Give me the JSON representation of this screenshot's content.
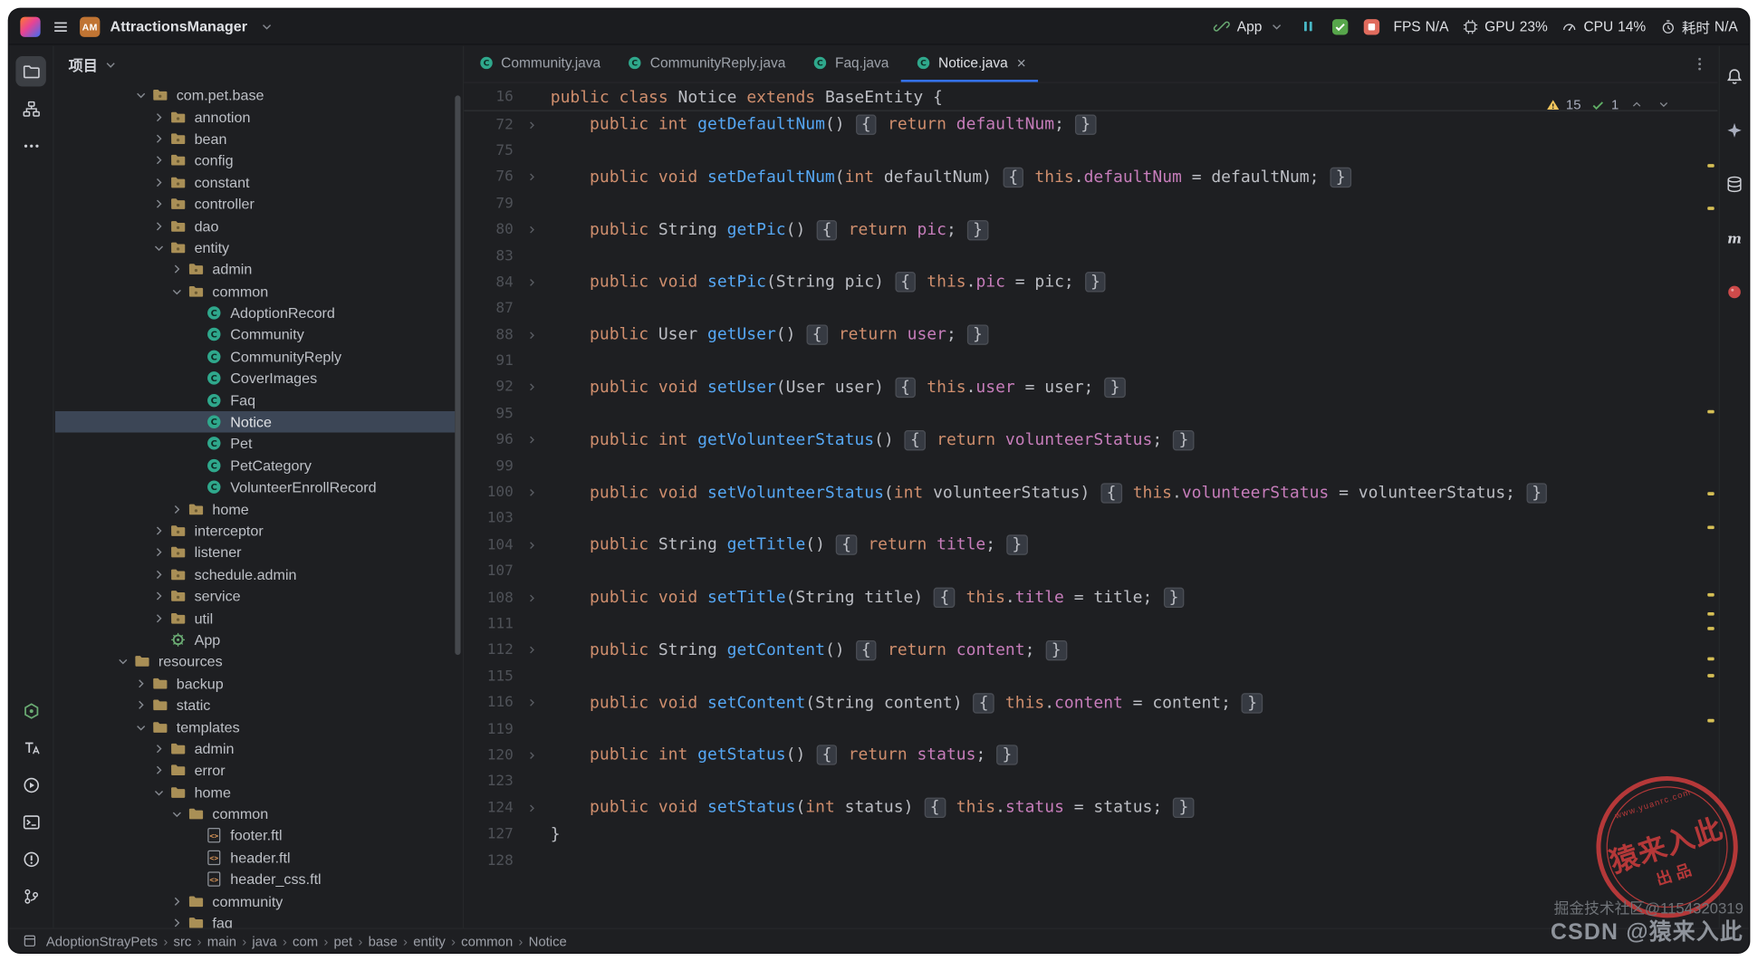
{
  "app": {
    "name": "AttractionsManager",
    "badge": "AM"
  },
  "titlebar": {
    "run_widget": {
      "config_name": "App"
    },
    "monitors": [
      {
        "icon": "",
        "label": "FPS",
        "value": "N/A"
      },
      {
        "icon": "gpu-icon",
        "label": "GPU",
        "value": "23%"
      },
      {
        "icon": "cpu-icon",
        "label": "CPU",
        "value": "14%"
      },
      {
        "icon": "timer-icon",
        "label": "耗时",
        "value": "N/A"
      }
    ]
  },
  "activity_bar": {
    "top": [
      "project-icon",
      "structure-icon",
      "more-icon"
    ],
    "bottom": [
      "plugin-green-icon",
      "translation-icon",
      "services-icon",
      "terminal-icon",
      "problems-icon",
      "version-control-icon"
    ]
  },
  "right_bar": {
    "icons": [
      "notifications-bell-icon",
      "ai-assistant-icon",
      "database-icon",
      "maven-icon",
      "plugin-red-icon"
    ]
  },
  "project_panel": {
    "title": "项目",
    "tree": [
      {
        "label": "com.pet.base",
        "depth": 3,
        "state": "expanded",
        "icon": "package-icon"
      },
      {
        "label": "annotion",
        "depth": 4,
        "state": "collapsed",
        "icon": "package-icon"
      },
      {
        "label": "bean",
        "depth": 4,
        "state": "collapsed",
        "icon": "package-icon"
      },
      {
        "label": "config",
        "depth": 4,
        "state": "collapsed",
        "icon": "package-icon"
      },
      {
        "label": "constant",
        "depth": 4,
        "state": "collapsed",
        "icon": "package-icon"
      },
      {
        "label": "controller",
        "depth": 4,
        "state": "collapsed",
        "icon": "package-icon"
      },
      {
        "label": "dao",
        "depth": 4,
        "state": "collapsed",
        "icon": "package-icon"
      },
      {
        "label": "entity",
        "depth": 4,
        "state": "expanded",
        "icon": "package-icon"
      },
      {
        "label": "admin",
        "depth": 5,
        "state": "collapsed",
        "icon": "package-icon"
      },
      {
        "label": "common",
        "depth": 5,
        "state": "expanded",
        "icon": "package-icon"
      },
      {
        "label": "AdoptionRecord",
        "depth": 6,
        "state": "leaf",
        "icon": "class-icon"
      },
      {
        "label": "Community",
        "depth": 6,
        "state": "leaf",
        "icon": "class-icon"
      },
      {
        "label": "CommunityReply",
        "depth": 6,
        "state": "leaf",
        "icon": "class-icon"
      },
      {
        "label": "CoverImages",
        "depth": 6,
        "state": "leaf",
        "icon": "class-icon"
      },
      {
        "label": "Faq",
        "depth": 6,
        "state": "leaf",
        "icon": "class-icon"
      },
      {
        "label": "Notice",
        "depth": 6,
        "state": "leaf",
        "icon": "class-icon",
        "selected": true
      },
      {
        "label": "Pet",
        "depth": 6,
        "state": "leaf",
        "icon": "class-icon"
      },
      {
        "label": "PetCategory",
        "depth": 6,
        "state": "leaf",
        "icon": "class-icon"
      },
      {
        "label": "VolunteerEnrollRecord",
        "depth": 6,
        "state": "leaf",
        "icon": "class-icon"
      },
      {
        "label": "home",
        "depth": 5,
        "state": "collapsed",
        "icon": "package-icon"
      },
      {
        "label": "interceptor",
        "depth": 4,
        "state": "collapsed",
        "icon": "package-icon"
      },
      {
        "label": "listener",
        "depth": 4,
        "state": "collapsed",
        "icon": "package-icon"
      },
      {
        "label": "schedule.admin",
        "depth": 4,
        "state": "collapsed",
        "icon": "package-icon"
      },
      {
        "label": "service",
        "depth": 4,
        "state": "collapsed",
        "icon": "package-icon"
      },
      {
        "label": "util",
        "depth": 4,
        "state": "collapsed",
        "icon": "package-icon"
      },
      {
        "label": "App",
        "depth": 4,
        "state": "leaf",
        "icon": "app-icon"
      },
      {
        "label": "resources",
        "depth": 2,
        "state": "expanded",
        "icon": "folder-icon"
      },
      {
        "label": "backup",
        "depth": 3,
        "state": "collapsed",
        "icon": "folder-icon"
      },
      {
        "label": "static",
        "depth": 3,
        "state": "collapsed",
        "icon": "folder-icon"
      },
      {
        "label": "templates",
        "depth": 3,
        "state": "expanded",
        "icon": "folder-icon"
      },
      {
        "label": "admin",
        "depth": 4,
        "state": "collapsed",
        "icon": "folder-icon"
      },
      {
        "label": "error",
        "depth": 4,
        "state": "collapsed",
        "icon": "folder-icon"
      },
      {
        "label": "home",
        "depth": 4,
        "state": "expanded",
        "icon": "folder-icon"
      },
      {
        "label": "common",
        "depth": 5,
        "state": "expanded",
        "icon": "folder-icon"
      },
      {
        "label": "footer.ftl",
        "depth": 6,
        "state": "leaf",
        "icon": "ftl-file-icon"
      },
      {
        "label": "header.ftl",
        "depth": 6,
        "state": "leaf",
        "icon": "ftl-file-icon"
      },
      {
        "label": "header_css.ftl",
        "depth": 6,
        "state": "leaf",
        "icon": "ftl-file-icon"
      },
      {
        "label": "community",
        "depth": 5,
        "state": "collapsed",
        "icon": "folder-icon"
      },
      {
        "label": "faq",
        "depth": 5,
        "state": "collapsed",
        "icon": "folder-icon"
      }
    ]
  },
  "editor": {
    "tabs": [
      {
        "label": "Community.java"
      },
      {
        "label": "CommunityReply.java"
      },
      {
        "label": "Faq.java"
      },
      {
        "label": "Notice.java",
        "active": true,
        "closable": true
      }
    ],
    "inspections": {
      "warnings": "15",
      "passed": "1"
    },
    "lines": [
      {
        "n": "16",
        "sticky": true,
        "seg": [
          [
            "k",
            "public "
          ],
          [
            "k",
            "class "
          ],
          [
            "p",
            "Notice "
          ],
          [
            "k",
            "extends "
          ],
          [
            "p",
            "BaseEntity "
          ],
          [
            "p",
            "{"
          ]
        ]
      },
      {
        "n": "72",
        "fold": true,
        "seg": [
          [
            "p",
            "    "
          ],
          [
            "k",
            "public "
          ],
          [
            "k",
            "int "
          ],
          [
            "m",
            "getDefaultNum"
          ],
          [
            "p",
            "() "
          ],
          [
            "b",
            "{"
          ],
          [
            "p",
            " "
          ],
          [
            "k",
            "return "
          ],
          [
            "f",
            "defaultNum"
          ],
          [
            "p",
            "; "
          ],
          [
            "b",
            "}"
          ]
        ]
      },
      {
        "n": "75",
        "seg": []
      },
      {
        "n": "76",
        "fold": true,
        "seg": [
          [
            "p",
            "    "
          ],
          [
            "k",
            "public "
          ],
          [
            "k",
            "void "
          ],
          [
            "m",
            "setDefaultNum"
          ],
          [
            "p",
            "("
          ],
          [
            "k",
            "int"
          ],
          [
            "p",
            " defaultNum) "
          ],
          [
            "b",
            "{"
          ],
          [
            "p",
            " "
          ],
          [
            "k",
            "this"
          ],
          [
            "p",
            "."
          ],
          [
            "f",
            "defaultNum"
          ],
          [
            "p",
            " = defaultNum; "
          ],
          [
            "b",
            "}"
          ]
        ]
      },
      {
        "n": "79",
        "seg": []
      },
      {
        "n": "80",
        "fold": true,
        "seg": [
          [
            "p",
            "    "
          ],
          [
            "k",
            "public "
          ],
          [
            "p",
            "String "
          ],
          [
            "m",
            "getPic"
          ],
          [
            "p",
            "() "
          ],
          [
            "b",
            "{"
          ],
          [
            "p",
            " "
          ],
          [
            "k",
            "return "
          ],
          [
            "f",
            "pic"
          ],
          [
            "p",
            "; "
          ],
          [
            "b",
            "}"
          ]
        ]
      },
      {
        "n": "83",
        "seg": []
      },
      {
        "n": "84",
        "fold": true,
        "seg": [
          [
            "p",
            "    "
          ],
          [
            "k",
            "public "
          ],
          [
            "k",
            "void "
          ],
          [
            "m",
            "setPic"
          ],
          [
            "p",
            "(String pic) "
          ],
          [
            "b",
            "{"
          ],
          [
            "p",
            " "
          ],
          [
            "k",
            "this"
          ],
          [
            "p",
            "."
          ],
          [
            "f",
            "pic"
          ],
          [
            "p",
            " = pic; "
          ],
          [
            "b",
            "}"
          ]
        ]
      },
      {
        "n": "87",
        "seg": []
      },
      {
        "n": "88",
        "fold": true,
        "seg": [
          [
            "p",
            "    "
          ],
          [
            "k",
            "public "
          ],
          [
            "p",
            "User "
          ],
          [
            "m",
            "getUser"
          ],
          [
            "p",
            "() "
          ],
          [
            "b",
            "{"
          ],
          [
            "p",
            " "
          ],
          [
            "k",
            "return "
          ],
          [
            "f",
            "user"
          ],
          [
            "p",
            "; "
          ],
          [
            "b",
            "}"
          ]
        ]
      },
      {
        "n": "91",
        "seg": []
      },
      {
        "n": "92",
        "fold": true,
        "seg": [
          [
            "p",
            "    "
          ],
          [
            "k",
            "public "
          ],
          [
            "k",
            "void "
          ],
          [
            "m",
            "setUser"
          ],
          [
            "p",
            "(User user) "
          ],
          [
            "b",
            "{"
          ],
          [
            "p",
            " "
          ],
          [
            "k",
            "this"
          ],
          [
            "p",
            "."
          ],
          [
            "f",
            "user"
          ],
          [
            "p",
            " = user; "
          ],
          [
            "b",
            "}"
          ]
        ]
      },
      {
        "n": "95",
        "seg": []
      },
      {
        "n": "96",
        "fold": true,
        "seg": [
          [
            "p",
            "    "
          ],
          [
            "k",
            "public "
          ],
          [
            "k",
            "int "
          ],
          [
            "m",
            "getVolunteerStatus"
          ],
          [
            "p",
            "() "
          ],
          [
            "b",
            "{"
          ],
          [
            "p",
            " "
          ],
          [
            "k",
            "return "
          ],
          [
            "f",
            "volunteerStatus"
          ],
          [
            "p",
            "; "
          ],
          [
            "b",
            "}"
          ]
        ]
      },
      {
        "n": "99",
        "seg": []
      },
      {
        "n": "100",
        "fold": true,
        "seg": [
          [
            "p",
            "    "
          ],
          [
            "k",
            "public "
          ],
          [
            "k",
            "void "
          ],
          [
            "m",
            "setVolunteerStatus"
          ],
          [
            "p",
            "("
          ],
          [
            "k",
            "int"
          ],
          [
            "p",
            " volunteerStatus) "
          ],
          [
            "b",
            "{"
          ],
          [
            "p",
            " "
          ],
          [
            "k",
            "this"
          ],
          [
            "p",
            "."
          ],
          [
            "f",
            "volunteerStatus"
          ],
          [
            "p",
            " = volunteerStatus; "
          ],
          [
            "b",
            "}"
          ]
        ]
      },
      {
        "n": "103",
        "seg": []
      },
      {
        "n": "104",
        "fold": true,
        "seg": [
          [
            "p",
            "    "
          ],
          [
            "k",
            "public "
          ],
          [
            "p",
            "String "
          ],
          [
            "m",
            "getTitle"
          ],
          [
            "p",
            "() "
          ],
          [
            "b",
            "{"
          ],
          [
            "p",
            " "
          ],
          [
            "k",
            "return "
          ],
          [
            "f",
            "title"
          ],
          [
            "p",
            "; "
          ],
          [
            "b",
            "}"
          ]
        ]
      },
      {
        "n": "107",
        "seg": []
      },
      {
        "n": "108",
        "fold": true,
        "seg": [
          [
            "p",
            "    "
          ],
          [
            "k",
            "public "
          ],
          [
            "k",
            "void "
          ],
          [
            "m",
            "setTitle"
          ],
          [
            "p",
            "(String title) "
          ],
          [
            "b",
            "{"
          ],
          [
            "p",
            " "
          ],
          [
            "k",
            "this"
          ],
          [
            "p",
            "."
          ],
          [
            "f",
            "title"
          ],
          [
            "p",
            " = title; "
          ],
          [
            "b",
            "}"
          ]
        ]
      },
      {
        "n": "111",
        "seg": []
      },
      {
        "n": "112",
        "fold": true,
        "seg": [
          [
            "p",
            "    "
          ],
          [
            "k",
            "public "
          ],
          [
            "p",
            "String "
          ],
          [
            "m",
            "getContent"
          ],
          [
            "p",
            "() "
          ],
          [
            "b",
            "{"
          ],
          [
            "p",
            " "
          ],
          [
            "k",
            "return "
          ],
          [
            "f",
            "content"
          ],
          [
            "p",
            "; "
          ],
          [
            "b",
            "}"
          ]
        ]
      },
      {
        "n": "115",
        "seg": []
      },
      {
        "n": "116",
        "fold": true,
        "seg": [
          [
            "p",
            "    "
          ],
          [
            "k",
            "public "
          ],
          [
            "k",
            "void "
          ],
          [
            "m",
            "setContent"
          ],
          [
            "p",
            "(String content) "
          ],
          [
            "b",
            "{"
          ],
          [
            "p",
            " "
          ],
          [
            "k",
            "this"
          ],
          [
            "p",
            "."
          ],
          [
            "f",
            "content"
          ],
          [
            "p",
            " = content; "
          ],
          [
            "b",
            "}"
          ]
        ]
      },
      {
        "n": "119",
        "seg": []
      },
      {
        "n": "120",
        "fold": true,
        "seg": [
          [
            "p",
            "    "
          ],
          [
            "k",
            "public "
          ],
          [
            "k",
            "int "
          ],
          [
            "m",
            "getStatus"
          ],
          [
            "p",
            "() "
          ],
          [
            "b",
            "{"
          ],
          [
            "p",
            " "
          ],
          [
            "k",
            "return "
          ],
          [
            "f",
            "status"
          ],
          [
            "p",
            "; "
          ],
          [
            "b",
            "}"
          ]
        ]
      },
      {
        "n": "123",
        "seg": []
      },
      {
        "n": "124",
        "fold": true,
        "seg": [
          [
            "p",
            "    "
          ],
          [
            "k",
            "public "
          ],
          [
            "k",
            "void "
          ],
          [
            "m",
            "setStatus"
          ],
          [
            "p",
            "("
          ],
          [
            "k",
            "int"
          ],
          [
            "p",
            " status) "
          ],
          [
            "b",
            "{"
          ],
          [
            "p",
            " "
          ],
          [
            "k",
            "this"
          ],
          [
            "p",
            "."
          ],
          [
            "f",
            "status"
          ],
          [
            "p",
            " = status; "
          ],
          [
            "b",
            "}"
          ]
        ]
      },
      {
        "n": "127",
        "seg": [
          [
            "p",
            "}"
          ]
        ]
      },
      {
        "n": "128",
        "seg": []
      }
    ]
  },
  "status_bar": {
    "breadcrumbs": [
      "AdoptionStrayPets",
      "src",
      "main",
      "java",
      "com",
      "pet",
      "base",
      "entity",
      "common",
      "Notice"
    ]
  },
  "watermarks": {
    "stamp": {
      "arc": "www.yuanrc.com",
      "main": "猿来入此",
      "sub": "出品"
    },
    "line1": "掘金技术社区@1154320319",
    "line2": "CSDN @猿来入此"
  },
  "colors": {
    "accent": "#3574F0",
    "keyword": "#CF8E6D",
    "method": "#56A8F5",
    "field": "#C77DBB",
    "plain": "#BCBEC4",
    "warning": "#F2C55C",
    "success": "#5FAD65",
    "selection": "#3C4656",
    "stamp_red": "#C23B3B",
    "editor_bg": "#1E1F22"
  }
}
